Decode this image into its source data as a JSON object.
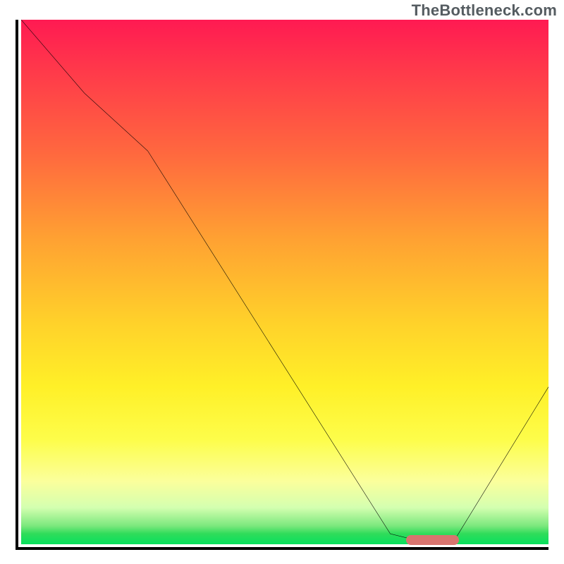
{
  "watermark": "TheBottleneck.com",
  "colors": {
    "gradient_top": "#ff1a52",
    "gradient_mid_orange": "#ffa232",
    "gradient_yellow": "#fff028",
    "gradient_green": "#08e05e",
    "curve": "#000000",
    "marker": "#d8746f",
    "axis": "#000000"
  },
  "chart_data": {
    "type": "line",
    "title": "",
    "xlabel": "",
    "ylabel": "",
    "xlim": [
      0,
      100
    ],
    "ylim": [
      0,
      100
    ],
    "grid": false,
    "legend": false,
    "x": [
      0,
      12,
      24,
      70,
      76,
      82,
      100
    ],
    "values": [
      100,
      86,
      75,
      2,
      0.5,
      0.5,
      30
    ],
    "annotations": [
      {
        "kind": "marker-pill",
        "x_start": 73,
        "x_end": 83,
        "y": 0.8,
        "color": "#d8746f"
      }
    ],
    "background_gradient_vertical": [
      {
        "stop": 0.0,
        "color": "#ff1a52"
      },
      {
        "stop": 0.1,
        "color": "#ff3a4a"
      },
      {
        "stop": 0.26,
        "color": "#ff6a3e"
      },
      {
        "stop": 0.42,
        "color": "#ffa232"
      },
      {
        "stop": 0.58,
        "color": "#ffd22a"
      },
      {
        "stop": 0.7,
        "color": "#fff028"
      },
      {
        "stop": 0.8,
        "color": "#fdfd4a"
      },
      {
        "stop": 0.88,
        "color": "#fbff9c"
      },
      {
        "stop": 0.93,
        "color": "#d4ffb0"
      },
      {
        "stop": 0.965,
        "color": "#7be87d"
      },
      {
        "stop": 0.98,
        "color": "#2fdc5a"
      },
      {
        "stop": 1.0,
        "color": "#08e05e"
      }
    ]
  }
}
